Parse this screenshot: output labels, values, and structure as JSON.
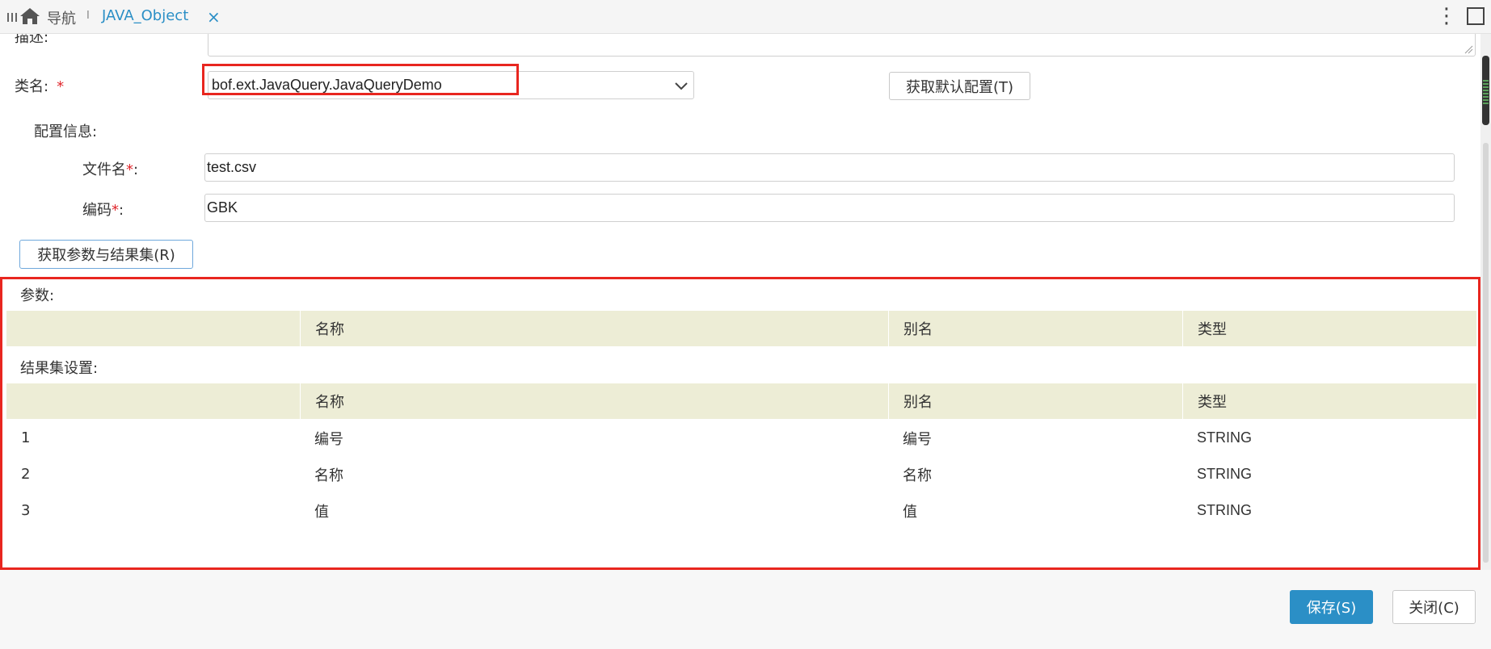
{
  "tabbar": {
    "nav_label": "导航",
    "separator": "I",
    "tab_label": "JAVA_Object",
    "close": "×",
    "more": "⋮"
  },
  "form": {
    "desc_label": "描述:",
    "class_label": "类名:",
    "required_mark": "*",
    "class_value": "bof.ext.JavaQuery.JavaQueryDemo",
    "default_config_button": "获取默认配置(T)",
    "config_info_label": "配置信息:",
    "filename_label": "文件名",
    "filename_value": "test.csv",
    "encoding_label": "编码",
    "encoding_value": "GBK",
    "colon": ":",
    "fetch_button": "获取参数与结果集(R)"
  },
  "params": {
    "label": "参数:",
    "columns": [
      "",
      "名称",
      "别名",
      "类型"
    ]
  },
  "resultset": {
    "label": "结果集设置:",
    "columns": [
      "",
      "名称",
      "别名",
      "类型"
    ],
    "rows": [
      {
        "index": "1",
        "name": "编号",
        "alias": "编号",
        "type": "STRING"
      },
      {
        "index": "2",
        "name": "名称",
        "alias": "名称",
        "type": "STRING"
      },
      {
        "index": "3",
        "name": "值",
        "alias": "值",
        "type": "STRING"
      }
    ]
  },
  "footer": {
    "save_button": "保存(S)",
    "close_button": "关闭(C)"
  },
  "colors": {
    "accent": "#2b8fc6",
    "highlight": "#e8261f",
    "table_header": "#ededd6"
  }
}
